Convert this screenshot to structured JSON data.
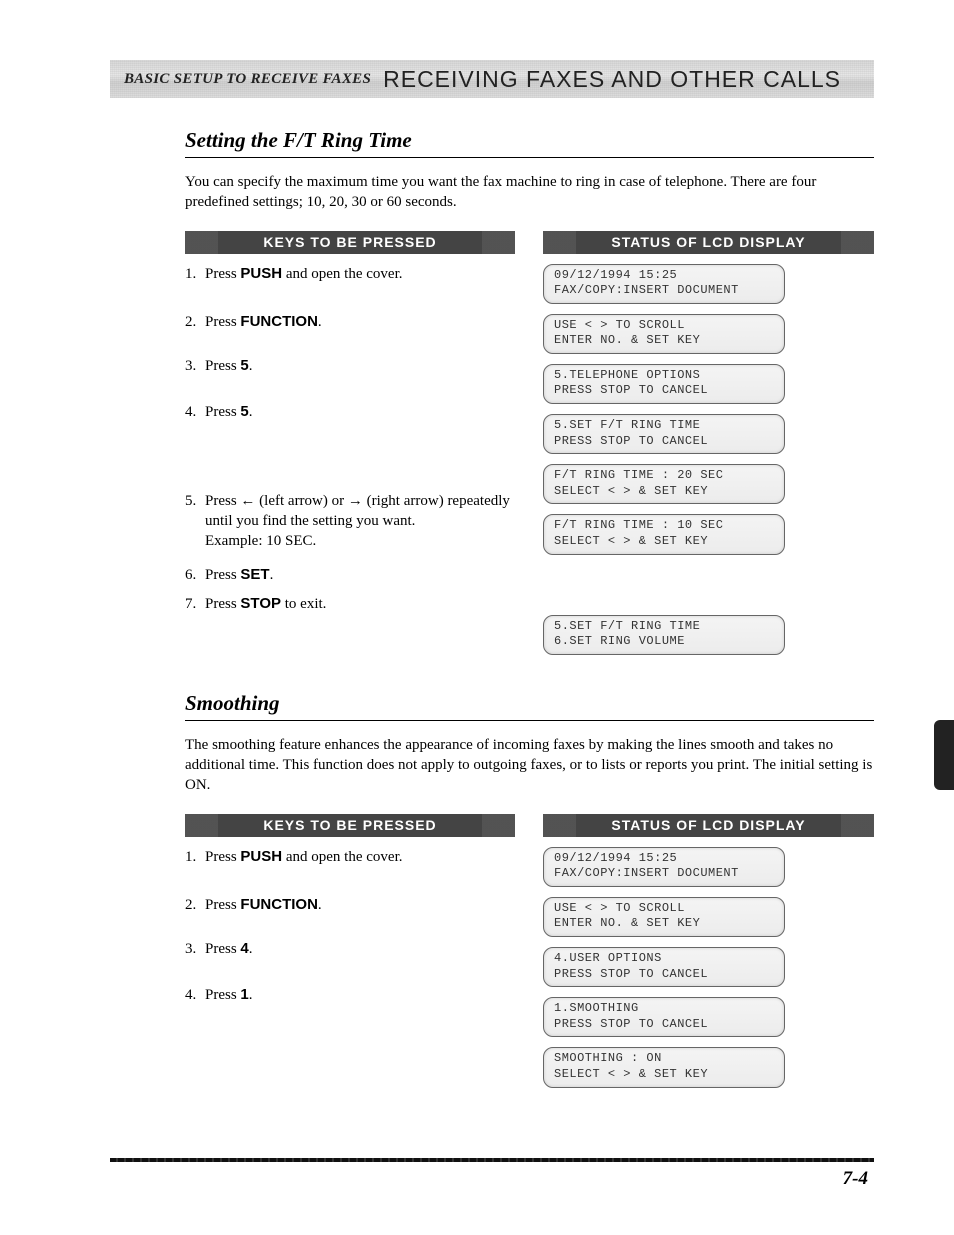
{
  "banner": {
    "left": "BASIC SETUP TO RECEIVE FAXES",
    "right": "RECEIVING FAXES AND OTHER CALLS"
  },
  "section1": {
    "title": "Setting the F/T Ring Time",
    "intro": "You can specify the maximum time you want the fax machine to ring in case of telephone. There are four predefined settings; 10, 20, 30 or 60 seconds.",
    "keys_header": "KEYS TO BE PRESSED",
    "lcd_header": "STATUS OF LCD DISPLAY",
    "steps": [
      {
        "n": "1.",
        "pre": "Press ",
        "bold": "PUSH",
        "post": " and open the cover."
      },
      {
        "n": "2.",
        "pre": "Press ",
        "bold": "FUNCTION",
        "post": "."
      },
      {
        "n": "3.",
        "pre": "Press ",
        "bold": "5",
        "post": "."
      },
      {
        "n": "4.",
        "pre": "Press ",
        "bold": "5",
        "post": "."
      },
      {
        "n": "5.",
        "pre": "Press  ",
        "arrowL": "←",
        "mid1": "  (left arrow) or  ",
        "arrowR": "→",
        "mid2": "  (right arrow) repeatedly until you find the setting you want.",
        "ex": "Example: 10 SEC."
      },
      {
        "n": "6.",
        "pre": "Press ",
        "bold": "SET",
        "post": "."
      },
      {
        "n": "7.",
        "pre": "Press ",
        "bold": "STOP",
        "post": " to exit."
      }
    ],
    "lcds": [
      {
        "l1": "09/12/1994 15:25",
        "l2": "FAX/COPY:INSERT DOCUMENT"
      },
      {
        "l1": "USE < > TO SCROLL",
        "l2": "ENTER NO. & SET KEY"
      },
      {
        "l1": "5.TELEPHONE OPTIONS",
        "l2": "PRESS STOP TO CANCEL"
      },
      {
        "l1": "5.SET F/T RING TIME",
        "l2": "PRESS STOP TO CANCEL"
      },
      {
        "l1": "F/T RING TIME : 20 SEC",
        "l2": "SELECT < > & SET KEY"
      },
      {
        "l1": "F/T RING TIME : 10 SEC",
        "l2": "SELECT < > & SET KEY"
      },
      {
        "l1": "5.SET F/T RING TIME",
        "l2": "6.SET RING VOLUME"
      }
    ]
  },
  "section2": {
    "title": "Smoothing",
    "intro": "The smoothing feature enhances the appearance of incoming faxes by making the lines smooth and takes no additional time. This function does not apply to outgoing faxes, or to lists or reports you print. The initial setting is ON.",
    "keys_header": "KEYS TO BE PRESSED",
    "lcd_header": "STATUS OF LCD DISPLAY",
    "steps": [
      {
        "n": "1.",
        "pre": "Press ",
        "bold": "PUSH",
        "post": " and open the cover."
      },
      {
        "n": "2.",
        "pre": "Press ",
        "bold": "FUNCTION",
        "post": "."
      },
      {
        "n": "3.",
        "pre": "Press ",
        "bold": "4",
        "post": "."
      },
      {
        "n": "4.",
        "pre": "Press ",
        "bold": "1",
        "post": "."
      }
    ],
    "lcds": [
      {
        "l1": "09/12/1994 15:25",
        "l2": "FAX/COPY:INSERT DOCUMENT"
      },
      {
        "l1": "USE < > TO SCROLL",
        "l2": "ENTER NO. & SET KEY"
      },
      {
        "l1": "4.USER OPTIONS",
        "l2": "PRESS STOP TO CANCEL"
      },
      {
        "l1": "1.SMOOTHING",
        "l2": "PRESS STOP TO CANCEL"
      },
      {
        "l1": "SMOOTHING : ON",
        "l2": "SELECT < > & SET KEY"
      }
    ]
  },
  "page_number": "7-4"
}
